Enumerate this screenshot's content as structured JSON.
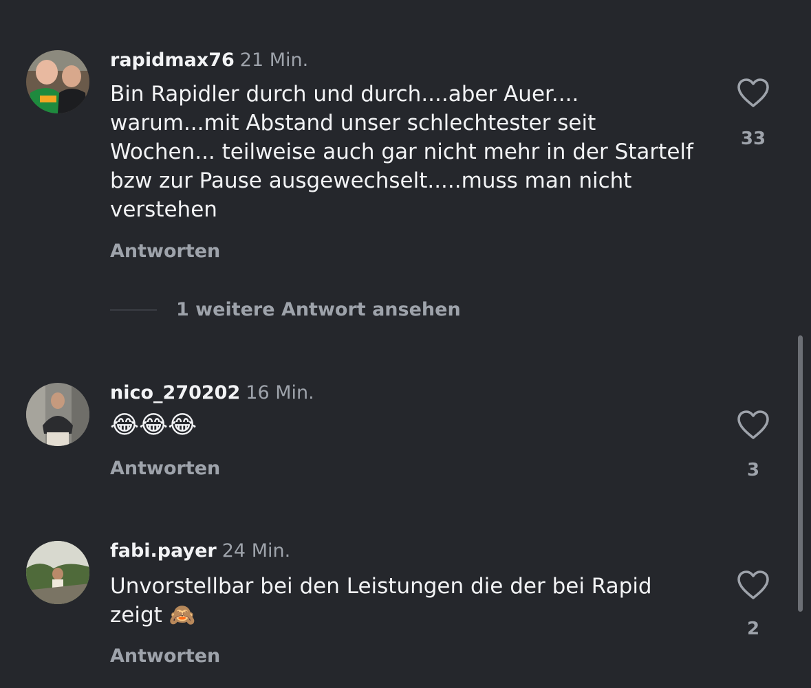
{
  "comments": [
    {
      "username": "rapidmax76",
      "time": "21 Min.",
      "text": "Bin Rapidler durch und durch....aber Auer.... warum...mit Abstand unser schlechtester seit Wochen... teilweise auch gar nicht mehr in der Startelf bzw zur Pause ausgewechselt.....muss man nicht verstehen",
      "reply_label": "Antworten",
      "likes": "33",
      "more_replies": "1 weitere Antwort ansehen"
    },
    {
      "username": "nico_270202",
      "time": "16 Min.",
      "text": "😂😂😂",
      "reply_label": "Antworten",
      "likes": "3"
    },
    {
      "username": "fabi.payer",
      "time": "24 Min.",
      "text": "Unvorstellbar bei den Leistungen die der bei Rapid zeigt 🙈",
      "reply_label": "Antworten",
      "likes": "2"
    }
  ],
  "icons": {
    "like": "heart-outline-icon"
  },
  "colors": {
    "background": "#25272c",
    "primary_text": "#f2f3f5",
    "secondary_text": "#9ea3ab"
  }
}
